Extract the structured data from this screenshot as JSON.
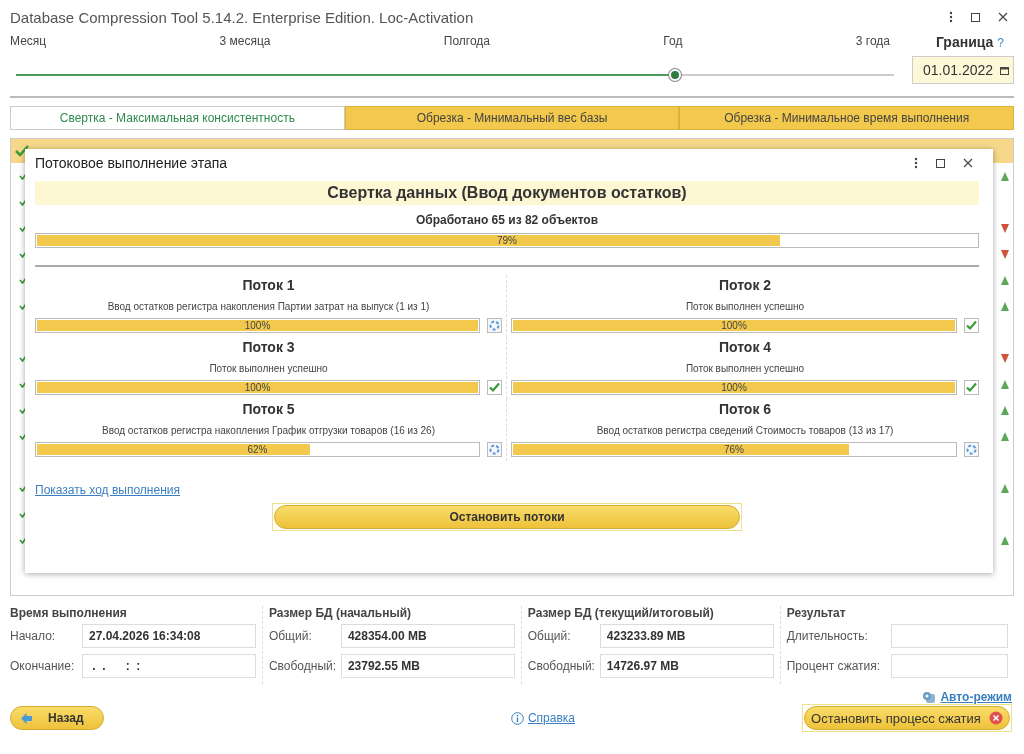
{
  "window": {
    "title": "Database Compression Tool 5.14.2. Enterprise Edition. Loc-Activation"
  },
  "period_slider": {
    "marks": [
      "Месяц",
      "3 месяца",
      "Полгода",
      "Год",
      "3 года"
    ],
    "level": 0.75
  },
  "boundary": {
    "label": "Граница",
    "help": "?",
    "value": "01.01.2022"
  },
  "tabs": [
    {
      "label": "Свертка - Максимальная консистентность",
      "selected": true
    },
    {
      "label": "Обрезка - Минимальный вес базы",
      "selected": false
    },
    {
      "label": "Обрезка - Минимальное время выполнения",
      "selected": false
    }
  ],
  "table": {
    "rows": [
      {
        "done": true,
        "arrow": true,
        "up": true
      },
      {
        "done": true,
        "arrow": false
      },
      {
        "done": true,
        "arrow": true,
        "up": false
      },
      {
        "done": true,
        "arrow": true,
        "up": false
      },
      {
        "done": true,
        "arrow": true,
        "up": true
      },
      {
        "done": true,
        "arrow": true,
        "up": true
      },
      {
        "done": false,
        "arrow": false
      },
      {
        "done": true,
        "arrow": true,
        "up": false
      },
      {
        "done": true,
        "arrow": true,
        "up": true
      },
      {
        "done": true,
        "arrow": true,
        "up": true
      },
      {
        "done": true,
        "arrow": true,
        "up": true
      },
      {
        "done": false,
        "arrow": false
      },
      {
        "done": true,
        "arrow": true,
        "up": true
      },
      {
        "done": true,
        "arrow": false
      },
      {
        "done": true,
        "arrow": true,
        "up": true
      }
    ]
  },
  "dialog": {
    "title": "Потоковое выполнение этапа",
    "heading": "Свертка данных (Ввод документов остатков)",
    "processed": "Обработано 65 из 82 объектов",
    "progress": {
      "level": 0.79,
      "reading": "79%"
    },
    "threads": [
      {
        "name": "Поток 1",
        "status": "Ввод остатков регистра накопления Партии затрат на выпуск (1 из 1)",
        "level": 1,
        "reading": "100%",
        "kind": "running"
      },
      {
        "name": "Поток 2",
        "status": "Поток выполнен успешно",
        "level": 1,
        "reading": "100%",
        "kind": "done"
      },
      {
        "name": "Поток 3",
        "status": "Поток выполнен успешно",
        "level": 1,
        "reading": "100%",
        "kind": "done"
      },
      {
        "name": "Поток 4",
        "status": "Поток выполнен успешно",
        "level": 1,
        "reading": "100%",
        "kind": "done"
      },
      {
        "name": "Поток 5",
        "status": "Ввод остатков регистра накопления График отгрузки товаров (16 из 26)",
        "level": 0.62,
        "reading": "62%",
        "kind": "running"
      },
      {
        "name": "Поток 6",
        "status": "Ввод остатков регистра сведений Стоимость товаров (13 из 17)",
        "level": 0.76,
        "reading": "76%",
        "kind": "running"
      }
    ],
    "link": "Показать ход выполнения",
    "stop_button": "Остановить потоки"
  },
  "summary": [
    {
      "title": "Время выполнения",
      "fields": [
        {
          "label": "Начало:",
          "value": "27.04.2026 16:34:08"
        },
        {
          "label": "Окончание:",
          "value": " .  .      :  :"
        }
      ]
    },
    {
      "title": "Размер БД (начальный)",
      "fields": [
        {
          "label": "Общий:",
          "value": "428354.00 MB"
        },
        {
          "label": "Свободный:",
          "value": "23792.55 MB"
        }
      ]
    },
    {
      "title": "Размер БД (текущий/итоговый)",
      "fields": [
        {
          "label": "Общий:",
          "value": "423233.89 MB"
        },
        {
          "label": "Свободный:",
          "value": "14726.97 MB"
        }
      ]
    },
    {
      "title": "Результат",
      "fields": [
        {
          "label": "Длительность:"
        },
        {
          "label": "Процент сжатия:"
        }
      ]
    }
  ],
  "auto_mode_link": "Авто-режим",
  "back_button": "Назад",
  "help_link": "Справка",
  "stop_compression_button": "Остановить процесс сжатия"
}
